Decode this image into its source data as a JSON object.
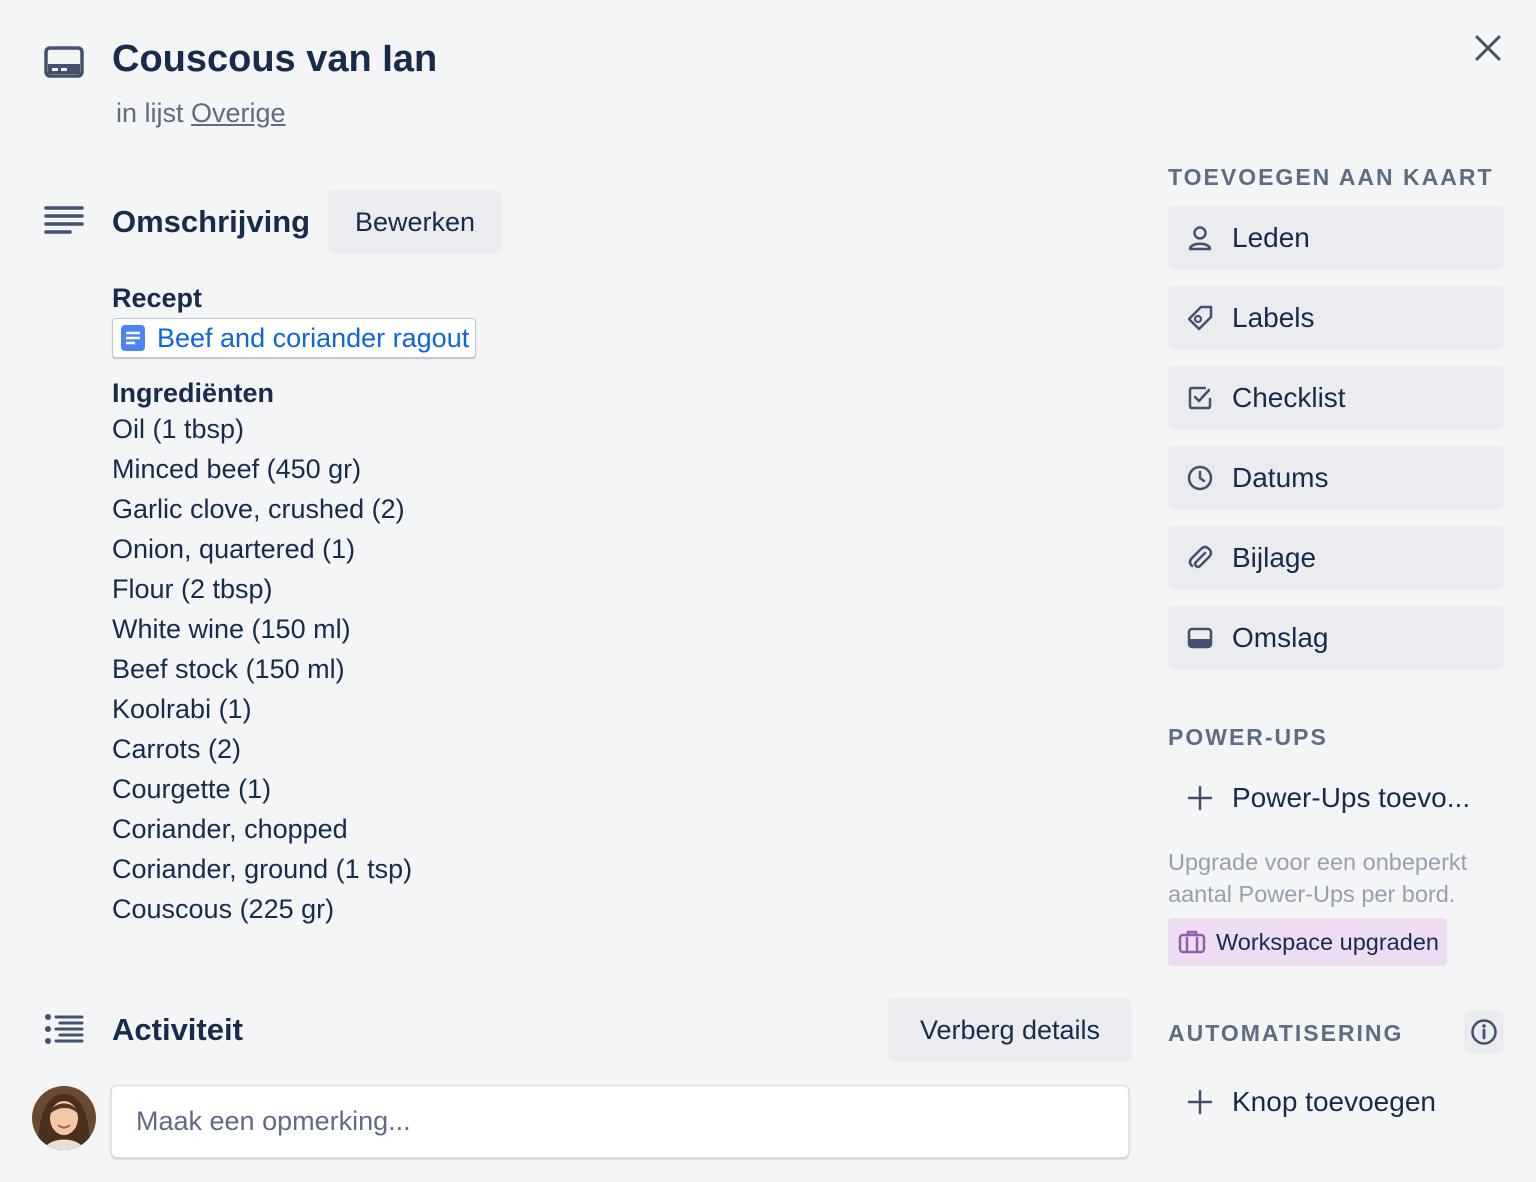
{
  "card": {
    "title": "Couscous van Ian",
    "list_prefix": "in lijst",
    "list_name": "Overige"
  },
  "description": {
    "heading": "Omschrijving",
    "edit_label": "Bewerken",
    "recipe_heading": "Recept",
    "recipe_link": "Beef and coriander ragout",
    "ingredients_heading": "Ingrediënten",
    "ingredients": [
      "Oil (1 tbsp)",
      "Minced beef (450 gr)",
      "Garlic clove, crushed (2)",
      "Onion, quartered (1)",
      "Flour (2 tbsp)",
      "White wine (150 ml)",
      "Beef stock (150 ml)",
      "Koolrabi (1)",
      "Carrots (2)",
      "Courgette (1)",
      "Coriander, chopped",
      "Coriander, ground (1 tsp)",
      "Couscous (225 gr)"
    ]
  },
  "activity": {
    "heading": "Activiteit",
    "toggle_label": "Verberg details",
    "comment_placeholder": "Maak een opmerking..."
  },
  "sidebar": {
    "add_heading": "TOEVOEGEN AAN KAART",
    "add_items": [
      {
        "label": "Leden",
        "icon": "person-icon"
      },
      {
        "label": "Labels",
        "icon": "tag-icon"
      },
      {
        "label": "Checklist",
        "icon": "checkbox-icon"
      },
      {
        "label": "Datums",
        "icon": "clock-icon"
      },
      {
        "label": "Bijlage",
        "icon": "paperclip-icon"
      },
      {
        "label": "Omslag",
        "icon": "cover-icon"
      }
    ],
    "powerups_heading": "POWER-UPS",
    "powerups_add": "Power-Ups toevo...",
    "upgrade_note": "Upgrade voor een onbeperkt aantal Power-Ups per bord.",
    "upgrade_button": "Workspace upgraden",
    "automation_heading": "AUTOMATISERING",
    "automation_add": "Knop toevoegen"
  },
  "colors": {
    "background": "#f4f5f7",
    "button": "#ebecf0",
    "text": "#172b4d",
    "muted": "#5e6c84",
    "link": "#0c66e4",
    "upgrade_bg": "#eddcf2",
    "upgrade_icon": "#8f5fa8"
  }
}
